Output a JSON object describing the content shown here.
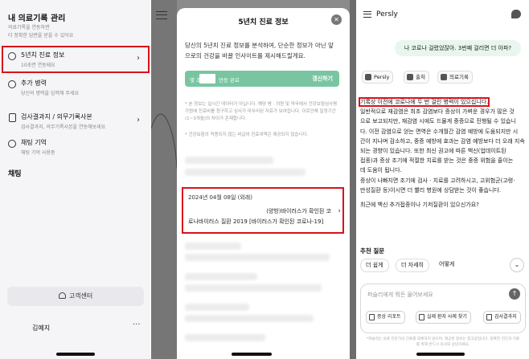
{
  "screen1": {
    "title": "내 의료기록 관리",
    "subtitle_1": "의료기록을 연동하면",
    "subtitle_2": "더 정확한 답변을 받을 수 있어요",
    "items": [
      {
        "label": "5년치 진료 정보",
        "desc": "10초면 연동돼요"
      },
      {
        "label": "추가 병력",
        "desc": "당신의 병력을 입력해 주세요"
      },
      {
        "label": "검사결과지 / 의무기록사본",
        "desc": "검사결과지, 의무기록사본을 연동해보세요"
      },
      {
        "label": "채팅 기억",
        "desc": "채팅 기억 사용중"
      }
    ],
    "chat_section": "채팅",
    "support_label": "고객센터",
    "user_name": "김예지",
    "more_label": "···"
  },
  "screen2": {
    "modal_title": "5년치 진료 정보",
    "close_label": "✕",
    "description": "당신의 5년치 진료 정보를 분석하여, 단순한 정보가 아닌 앞으로의 건강을 바꿀 인사이트를 제시해드릴게요.",
    "status_prefix": "몇 초 전 /",
    "status_suffix": "연동 완료",
    "refresh_label": "갱신하기",
    "notes": [
      "* 본 정보는 실시간 데이터가 아닙니다. 해당 병 · 의원 및 약국에서 건강보험심사평가원에 진료비를 청구하고 심사가 마무리된 자료가 보여집니다. 이로인해 일정기간(1~3개월)의 차이가 존재합니다.",
      "* 건강보험의 적용되지 않는 비급여 진료내역은 제공되지 않습니다."
    ],
    "record": {
      "date": "2024년 04월 08일 (외래)",
      "line1": "(양방)바이러스가 확인된 코",
      "line2": "로나바이러스 질환 2019 [바이러스가 확인된 코로나-19]"
    }
  },
  "screen3": {
    "brand": "Persly",
    "user_message": "나 코로나 걸렸었잖아. 3번째 걸리면 더 아파?",
    "source_chips": [
      "Persly",
      "출처",
      "의료기록"
    ],
    "answer_highlight": "기록상 이전에 코로나에 두 번 걸린 병력이 있으십니다.",
    "answer_lines": [
      "일반적으로 재감염은 최초 감염보다 증상이 가벼운 경우가 많은 것",
      "으로 보고되지만, 재감염 시에도 드물게 중증으로 진행될 수 있습니",
      "다. 이전 감염으로 얻는 면역은 수개월간 감염 예방에 도움되지만 시",
      "간이 지나며 감소하고, 중증 예방에 효과는 감염 예방보다 더 오래 지속",
      "되는 경향이 있습니다. 또한 최신 권고에 따른 백신(업데이트된",
      "접종)과 증상 조기에 적절한 치료를 받는 것은 중증 위험을 줄이는",
      "데 도움이 됩니다.",
      "증상이 나빠지면 조기에 검사 · 치료를 고려하시고, 고위험군(고령·",
      "만성질환 등)이시면 더 빨리 병원에 상담받는 것이 좋습니다."
    ],
    "answer_question": "최근에 백신 추가접종이나 기저질환이 있으신가요?",
    "suggest_title": "추천 질문",
    "suggestions": [
      "더 쉽게",
      "더 자세히",
      "어떻게"
    ],
    "scroll_label": "⌄",
    "input_placeholder": "퍼슬리에게 뭐든 물어보세요",
    "send_label": "↑",
    "tools": [
      "증상 리포트",
      "실제 환자 사례 찾기",
      "검사결과지"
    ],
    "disclaimer": "*퍼슬리는 의료 전문가의 진료를 대체하지 않으며, 제공된 정보는 참고용입니다. 정확한 진단과 치료를 위해 반드시 의사와 상담하세요."
  },
  "colors": {
    "highlight_red": "#d8141b",
    "green_bar": "#79c5a2",
    "bubble_green": "#e8f6ee"
  }
}
